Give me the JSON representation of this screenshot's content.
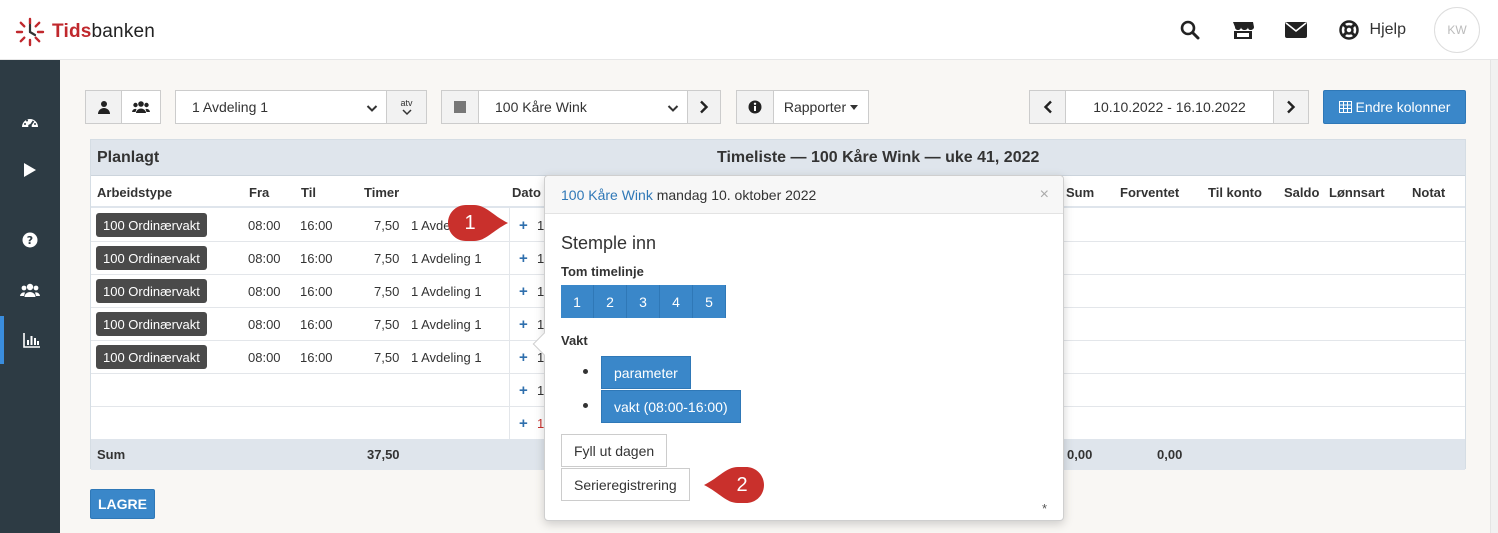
{
  "app": {
    "brand_prefix": "Tids",
    "brand_suffix": "banken",
    "help_label": "Hjelp",
    "avatar_initials": "KW"
  },
  "toolbar": {
    "department_select": "1 Avdeling 1",
    "department_suffix": "atv",
    "employee_select": "100 Kåre Wink",
    "reports_label": "Rapporter",
    "date_range": "10.10.2022 - 16.10.2022",
    "change_columns_label": "Endre kolonner"
  },
  "panel": {
    "title": "Planlagt",
    "center_title": "Timeliste — 100 Kåre Wink — uke 41, 2022",
    "columns": {
      "arbeidstype": "Arbeidstype",
      "fra": "Fra",
      "til": "Til",
      "timer": "Timer",
      "dato": "Dato",
      "sum": "Sum",
      "forventet": "Forventet",
      "til_konto": "Til konto",
      "saldo": "Saldo",
      "lonnsart": "Lønnsart",
      "notat": "Notat"
    },
    "rows": [
      {
        "type": "100 Ordinærvakt",
        "fra": "08:00",
        "til": "16:00",
        "timer": "7,50",
        "avdeling": "1 Avdeling 1",
        "dato": "1"
      },
      {
        "type": "100 Ordinærvakt",
        "fra": "08:00",
        "til": "16:00",
        "timer": "7,50",
        "avdeling": "1 Avdeling 1",
        "dato": "1"
      },
      {
        "type": "100 Ordinærvakt",
        "fra": "08:00",
        "til": "16:00",
        "timer": "7,50",
        "avdeling": "1 Avdeling 1",
        "dato": "1"
      },
      {
        "type": "100 Ordinærvakt",
        "fra": "08:00",
        "til": "16:00",
        "timer": "7,50",
        "avdeling": "1 Avdeling 1",
        "dato": "1"
      },
      {
        "type": "100 Ordinærvakt",
        "fra": "08:00",
        "til": "16:00",
        "timer": "7,50",
        "avdeling": "1 Avdeling 1",
        "dato": "1"
      }
    ],
    "empty_rows_dato": [
      "1",
      "1"
    ],
    "sum": {
      "label": "Sum",
      "timer": "37,50",
      "sum": "0,00",
      "forventet": "0,00"
    }
  },
  "save_label": "LAGRE",
  "popover": {
    "employee_link": "100 Kåre Wink",
    "date_text": "mandag 10. oktober 2022",
    "close": "×",
    "subtitle": "Stemple inn",
    "timeline_label": "Tom timelinje",
    "timeline_buttons": [
      "1",
      "2",
      "3",
      "4",
      "5"
    ],
    "vakt_label": "Vakt",
    "vakt_items": [
      "parameter",
      "vakt (08:00-16:00)"
    ],
    "fill_day_label": "Fyll ut dagen",
    "series_label": "Serieregistrering",
    "asterisk": "*"
  },
  "callouts": [
    "1",
    "2"
  ],
  "colors": {
    "brand_red": "#c0282d",
    "primary_blue": "#3a87c9",
    "sidebar_bg": "#2d3b44",
    "callout_red": "#c9302c"
  }
}
